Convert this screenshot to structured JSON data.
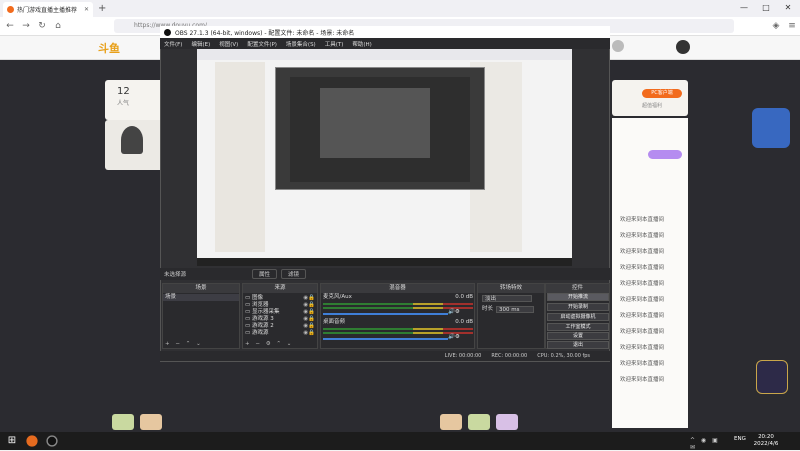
{
  "browser": {
    "tab_title": "热门游戏直播主播推荐",
    "new_tab": "+",
    "url": "https://www.douyu.com/",
    "win_min": "—",
    "win_max": "□",
    "win_close": "✕"
  },
  "site": {
    "logo": "斗鱼",
    "left_count": "12",
    "left_label": "人气",
    "btn_label": "PC客户端",
    "side_label": "超值福利"
  },
  "obs": {
    "title": "OBS 27.1.3 (64-bit, windows) - 配置文件: 未命名 - 场景: 未命名",
    "menu": [
      "文件(F)",
      "编辑(E)",
      "视图(V)",
      "配置文件(P)",
      "场景集合(S)",
      "工具(T)",
      "帮助(H)"
    ],
    "source_bar": {
      "label": "未选择源",
      "prop": "属性",
      "filter": "滤镜"
    },
    "scenes": {
      "title": "场景",
      "items": [
        "场景"
      ]
    },
    "sources": {
      "title": "来源",
      "items": [
        "图像",
        "浏览器",
        "显示器采集",
        "游戏源 3",
        "游戏源 2",
        "游戏源"
      ]
    },
    "mixer": {
      "title": "混音器",
      "tracks": [
        {
          "name": "麦克风/Aux",
          "db": "0.0 dB"
        },
        {
          "name": "桌面音频",
          "db": "0.0 dB"
        }
      ]
    },
    "transitions": {
      "title": "转场特效",
      "mode": "淡出",
      "dur_label": "时长",
      "duration": "300 ms"
    },
    "controls": {
      "title": "控件",
      "buttons": [
        "开始推流",
        "开始录制",
        "启动虚拟摄像机",
        "工作室模式",
        "设置",
        "退出"
      ]
    },
    "status": {
      "live": "LIVE: 00:00:00",
      "rec": "REC: 00:00:00",
      "cpu": "CPU: 0.2%, 30.00 fps"
    }
  },
  "chat": {
    "lines": [
      "欢迎来到本直播间",
      "欢迎来到本直播间",
      "欢迎来到本直播间",
      "欢迎来到本直播间",
      "欢迎来到本直播间",
      "欢迎来到本直播间",
      "欢迎来到本直播间",
      "欢迎来到本直播间",
      "欢迎来到本直播间",
      "欢迎来到本直播间",
      "欢迎来到本直播间"
    ]
  },
  "taskbar": {
    "lang": "ENG",
    "time": "20:20",
    "date": "2022/4/6"
  },
  "colors": {
    "accent": "#f26b1d",
    "obs_bg": "#303033",
    "stream_btn_active": "#5a5a60"
  }
}
